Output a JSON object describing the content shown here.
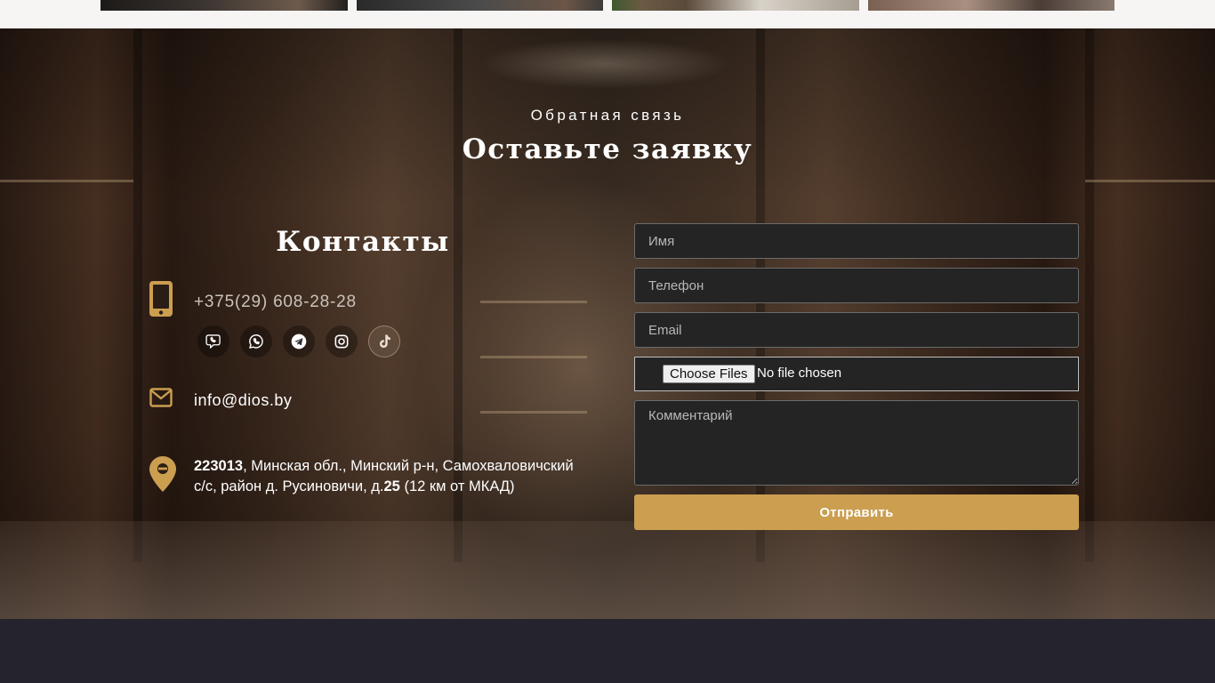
{
  "colors": {
    "accent_gold": "#cb9e50",
    "field_background": "#242424",
    "footer_background": "#24232e",
    "page_background": "#f7f5f4"
  },
  "feedback": {
    "eyebrow": "Обратная связь",
    "title": "Оставьте заявку"
  },
  "contacts": {
    "title": "Контакты",
    "phone": "+375(29) 608-28-28",
    "phone_icon": "mobile-phone-icon",
    "email": "info@dios.by",
    "email_icon": "envelope-icon",
    "address_icon": "map-pin-icon",
    "address": {
      "zip": "223013",
      "part1": ", Минская обл., Минский р-н, Самохваловичский с/с, район д. Русиновичи, д.",
      "house": "25",
      "part2": " (12 км от МКАД)"
    },
    "socials": [
      {
        "name": "viber",
        "icon": "viber-icon"
      },
      {
        "name": "whatsapp",
        "icon": "whatsapp-icon"
      },
      {
        "name": "telegram",
        "icon": "telegram-icon"
      },
      {
        "name": "instagram",
        "icon": "instagram-icon"
      },
      {
        "name": "tiktok",
        "icon": "tiktok-icon"
      }
    ]
  },
  "form": {
    "name_placeholder": "Имя",
    "phone_placeholder": "Телефон",
    "email_placeholder": "Email",
    "file_button": "Choose Files",
    "file_status": "No file chosen",
    "comment_placeholder": "Комментарий",
    "submit_label": "Отправить"
  }
}
